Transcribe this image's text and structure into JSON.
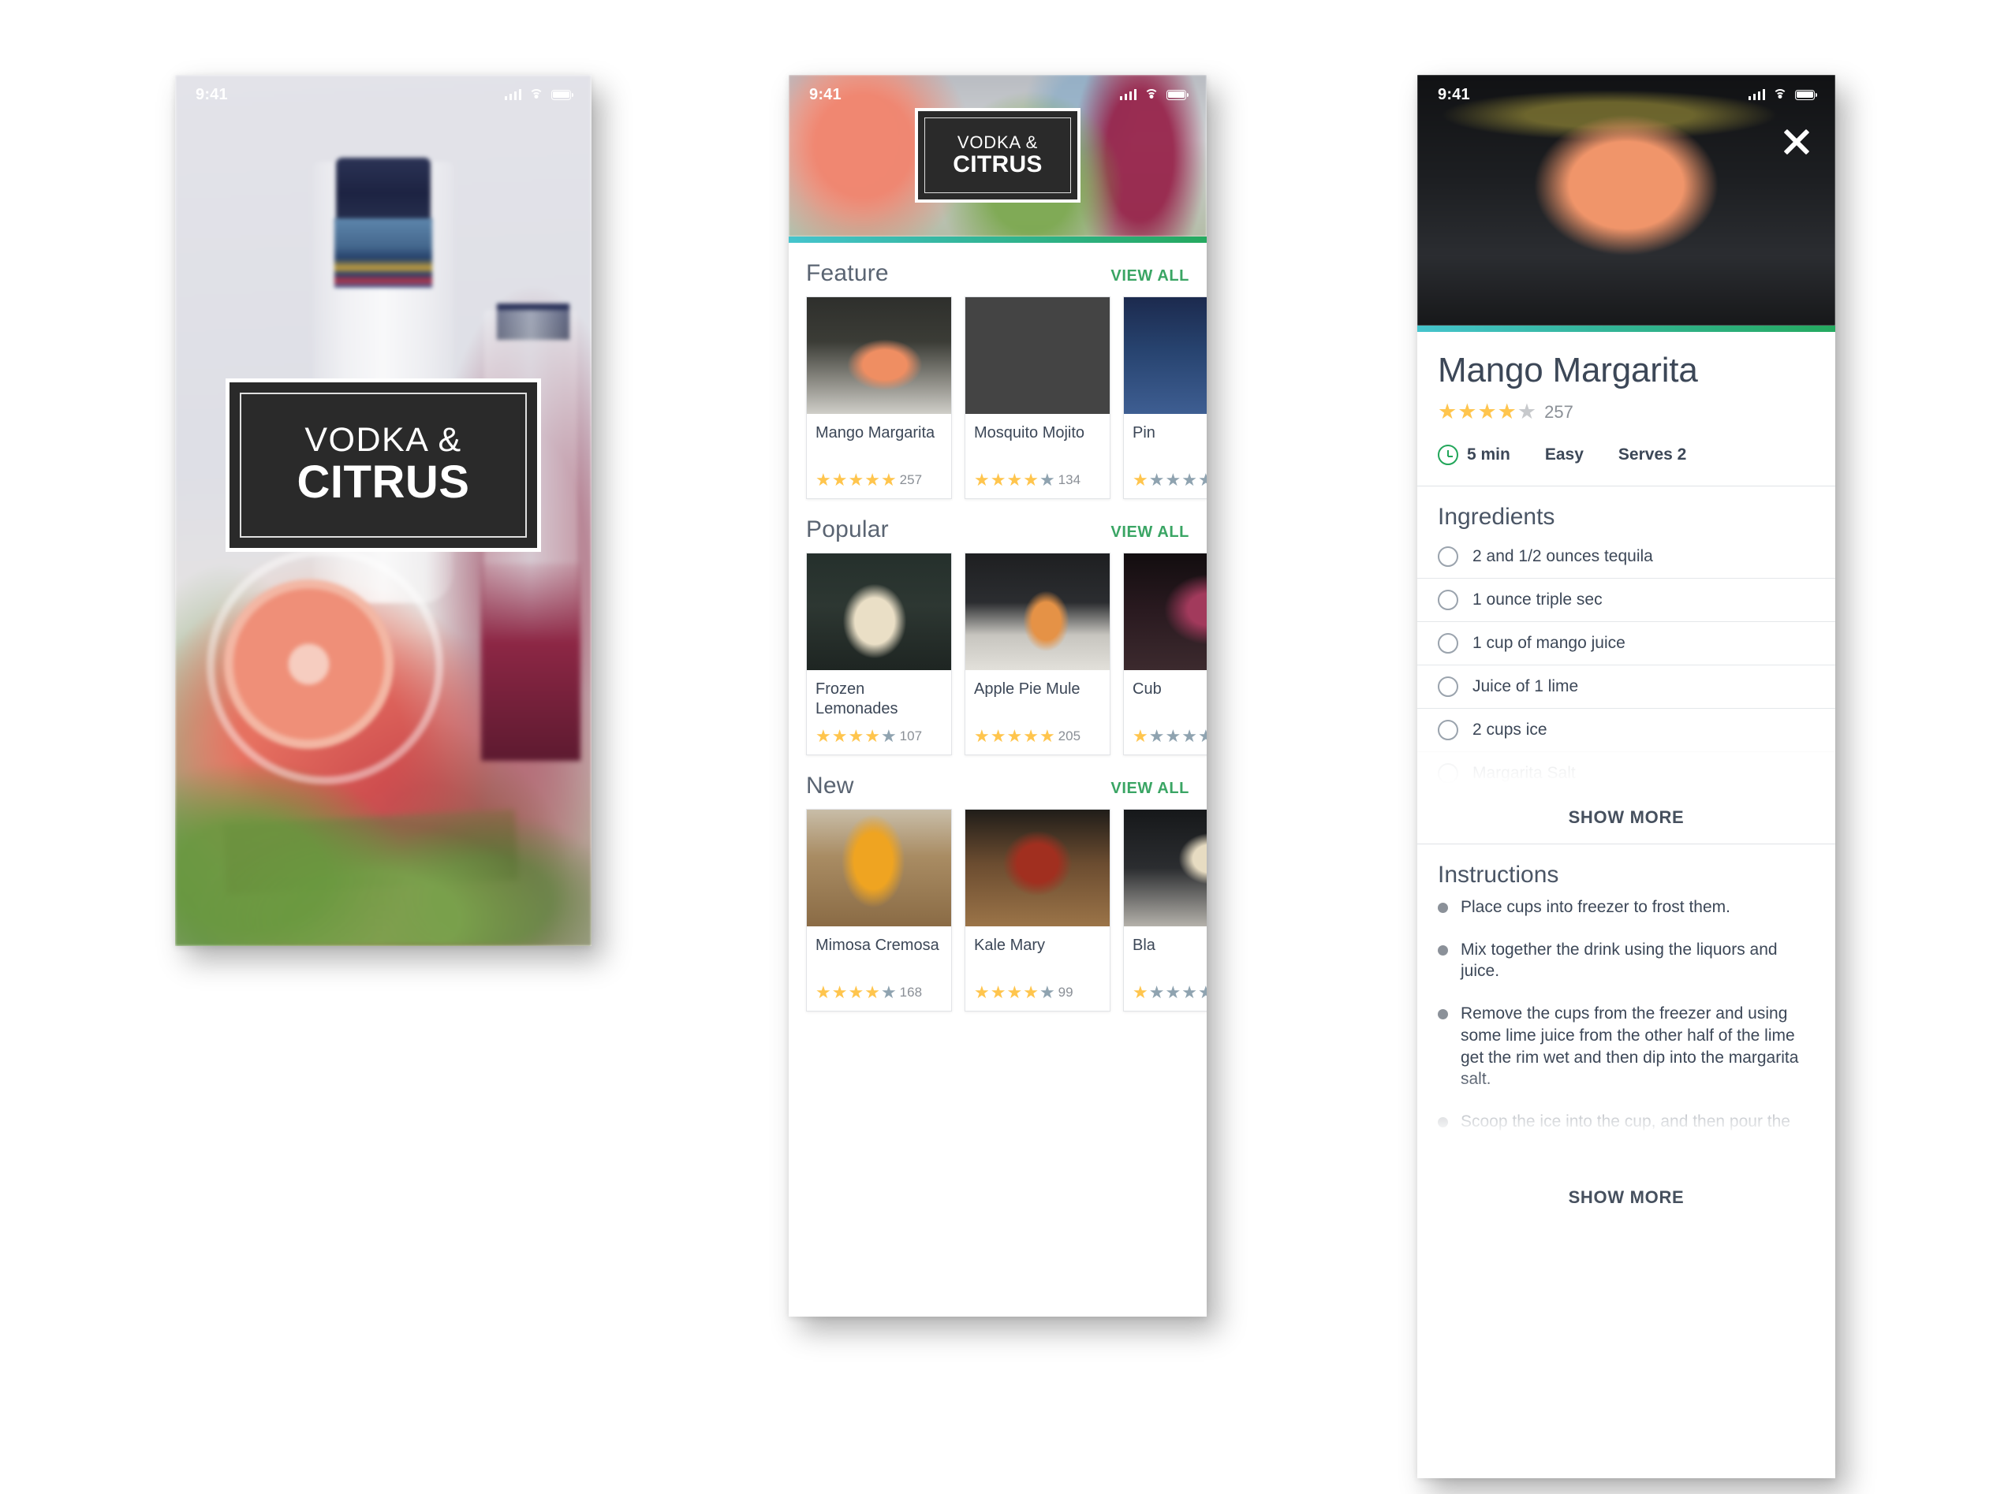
{
  "status_bar": {
    "time": "9:41"
  },
  "brand": {
    "line1": "VODKA &",
    "line2": "CITRUS"
  },
  "home": {
    "sections": [
      {
        "title": "Feature",
        "view_all": "VIEW ALL",
        "cards": [
          {
            "name": "Mango Margarita",
            "stars_filled": 5,
            "stars_total": 5,
            "count": "257",
            "photo": "ph-mango"
          },
          {
            "name": "Mosquito Mojito",
            "stars_filled": 4,
            "stars_total": 5,
            "count": "134",
            "photo": "ph-mosquito"
          },
          {
            "name": "Pin",
            "stars_filled": 1,
            "stars_total": 5,
            "count": "",
            "photo": "ph-pina"
          }
        ]
      },
      {
        "title": "Popular",
        "view_all": "VIEW ALL",
        "cards": [
          {
            "name": "Frozen Lemonades",
            "stars_filled": 4,
            "stars_total": 5,
            "count": "107",
            "photo": "ph-frozen"
          },
          {
            "name": "Apple Pie Mule",
            "stars_filled": 5,
            "stars_total": 5,
            "count": "205",
            "photo": "ph-apple"
          },
          {
            "name": "Cub",
            "stars_filled": 1,
            "stars_total": 5,
            "count": "",
            "photo": "ph-cuba"
          }
        ]
      },
      {
        "title": "New",
        "view_all": "VIEW ALL",
        "cards": [
          {
            "name": "Mimosa Cremosa",
            "stars_filled": 4,
            "stars_total": 5,
            "count": "168",
            "photo": "ph-mimosa"
          },
          {
            "name": "Kale Mary",
            "stars_filled": 4,
            "stars_total": 5,
            "count": "99",
            "photo": "ph-kale"
          },
          {
            "name": "Bla",
            "stars_filled": 1,
            "stars_total": 5,
            "count": "",
            "photo": "ph-black"
          }
        ]
      }
    ]
  },
  "detail": {
    "title": "Mango Margarita",
    "stars_filled": 4,
    "stars_total": 5,
    "rating_count": "257",
    "meta": {
      "time": "5 min",
      "difficulty": "Easy",
      "serves": "Serves 2"
    },
    "ingredients_title": "Ingredients",
    "ingredients": [
      {
        "text": "2 and 1/2 ounces tequila",
        "faded": false
      },
      {
        "text": "1 ounce triple sec",
        "faded": false
      },
      {
        "text": "1 cup of mango juice",
        "faded": false
      },
      {
        "text": "Juice of 1 lime",
        "faded": false
      },
      {
        "text": "2 cups ice",
        "faded": false
      },
      {
        "text": "Margarita Salt",
        "faded": true
      }
    ],
    "ingredients_show_more": "SHOW MORE",
    "instructions_title": "Instructions",
    "instructions": [
      "Place cups into freezer to frost them.",
      "Mix together the drink using the liquors and juice.",
      "Remove the cups from the freezer and using some lime juice from the other half of the lime get the rim wet and then dip into the margarita salt.",
      "Scoop the ice into the cup, and then pour the drink. Garnish with lime or other fruit as desired."
    ],
    "instructions_show_more": "SHOW MORE",
    "close_label": "Close"
  },
  "colors": {
    "accent_green": "#25a95f",
    "accent_teal": "#45c4cd",
    "star_gold": "#ffc54d",
    "star_off": "#8fa3b0",
    "text_dark": "#3c4757"
  }
}
